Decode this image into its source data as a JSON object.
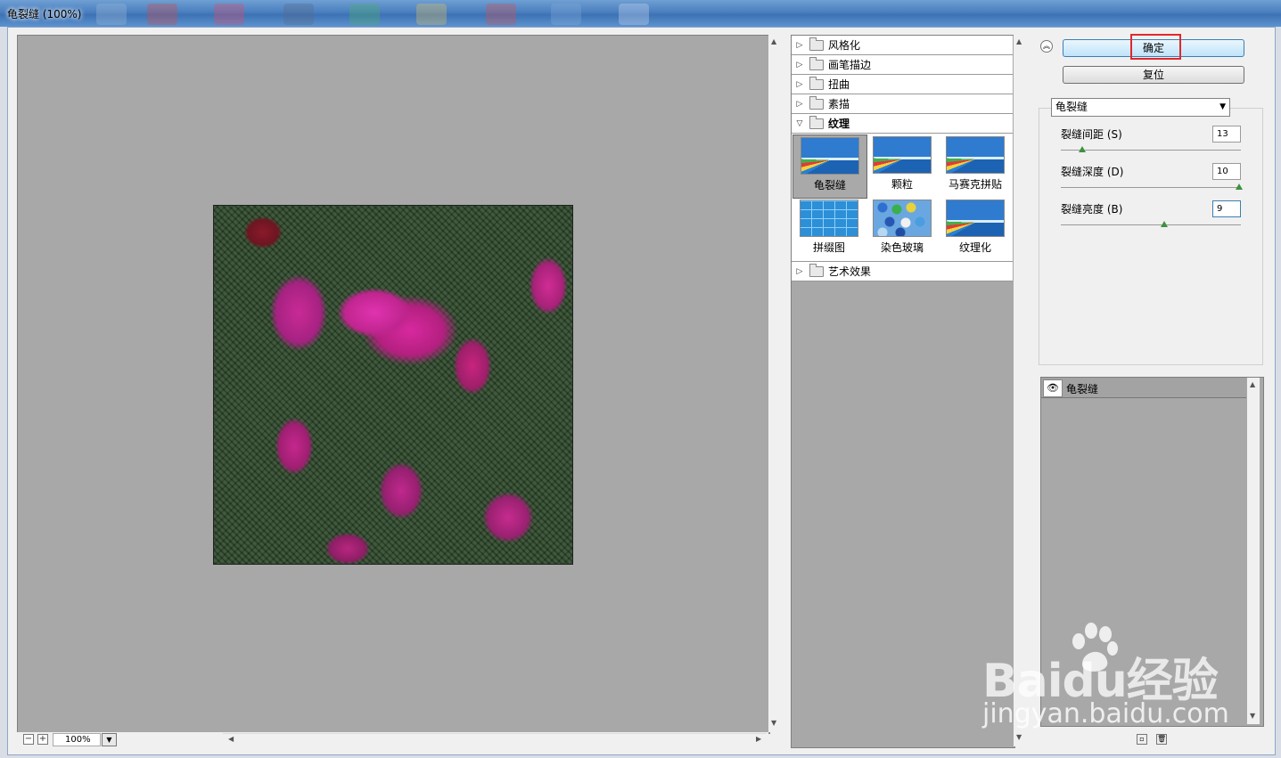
{
  "window": {
    "title": "龟裂缝 (100%)"
  },
  "preview": {
    "zoom": "100%"
  },
  "filter_categories": [
    {
      "label": "风格化",
      "expanded": false
    },
    {
      "label": "画笔描边",
      "expanded": false
    },
    {
      "label": "扭曲",
      "expanded": false
    },
    {
      "label": "素描",
      "expanded": false
    },
    {
      "label": "纹理",
      "expanded": true
    },
    {
      "label": "艺术效果",
      "expanded": false
    }
  ],
  "texture_filters": [
    {
      "label": "龟裂缝",
      "selected": true
    },
    {
      "label": "颗粒",
      "selected": false
    },
    {
      "label": "马赛克拼贴",
      "selected": false
    },
    {
      "label": "拼缀图",
      "selected": false
    },
    {
      "label": "染色玻璃",
      "selected": false
    },
    {
      "label": "纹理化",
      "selected": false
    }
  ],
  "buttons": {
    "ok": "确定",
    "reset": "复位"
  },
  "filter_select": {
    "value": "龟裂缝"
  },
  "params": [
    {
      "label": "裂缝间距",
      "hotkey": "(S)",
      "value": "13",
      "level": 0.12
    },
    {
      "label": "裂缝深度",
      "hotkey": "(D)",
      "value": "10",
      "level": 1.0
    },
    {
      "label": "裂缝亮度",
      "hotkey": "(B)",
      "value": "9",
      "level": 0.58
    }
  ],
  "effect_layer": {
    "label": "龟裂缝"
  },
  "watermark": {
    "brand": "Baidu经验",
    "url": "jingyan.baidu.com"
  },
  "colors": {
    "ok_highlight": "#e0282b",
    "knob": "#3d9141"
  }
}
